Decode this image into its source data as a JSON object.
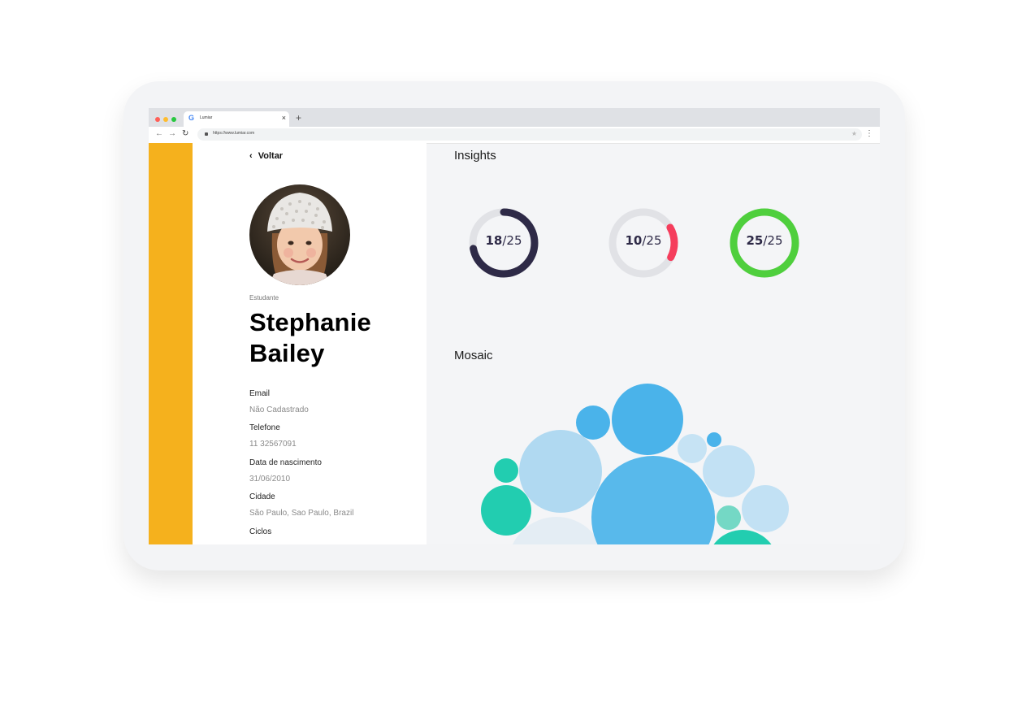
{
  "browser": {
    "tab_favicon": "G",
    "tab_title": "Lumiar",
    "tab_close": "×",
    "new_tab": "+",
    "url": "https://www.lumiar.com",
    "icons": [
      "back-arrow-icon",
      "forward-arrow-icon",
      "reload-icon",
      "lock-icon",
      "star-icon",
      "kebab-menu-icon"
    ],
    "traffic_lights": [
      "#ff5f57",
      "#febc2e",
      "#28c840"
    ]
  },
  "profile": {
    "back_label": "Voltar",
    "role": "Estudante",
    "name": "Stephanie Bailey",
    "fields": [
      {
        "label": "Email",
        "value": "Não Cadastrado"
      },
      {
        "label": "Telefone",
        "value": "11 32567091"
      },
      {
        "label": "Data de nascimento",
        "value": "31/06/2010"
      },
      {
        "label": "Cidade",
        "value": "São Paulo, Sao Paulo, Brazil"
      },
      {
        "label": "Ciclos",
        "value": ""
      }
    ]
  },
  "insights": {
    "title": "Insights",
    "rings": [
      {
        "value": "18",
        "total": "/25",
        "fraction": 0.72,
        "color": "#2e2a47"
      },
      {
        "value": "10",
        "total": "/25",
        "fraction": 0.16,
        "color": "#f53d5c"
      },
      {
        "value": "25",
        "total": "/25",
        "fraction": 1.0,
        "color": "#4fcf3d"
      }
    ]
  },
  "mosaic": {
    "title": "Mosaic"
  },
  "colors": {
    "sidebar_accent": "#f5b11d",
    "ring_track": "#e1e2e6",
    "bubble_blue": "#4ab3ea",
    "bubble_light_blue": "#b0d9f1",
    "bubble_teal": "#22cdb0"
  }
}
